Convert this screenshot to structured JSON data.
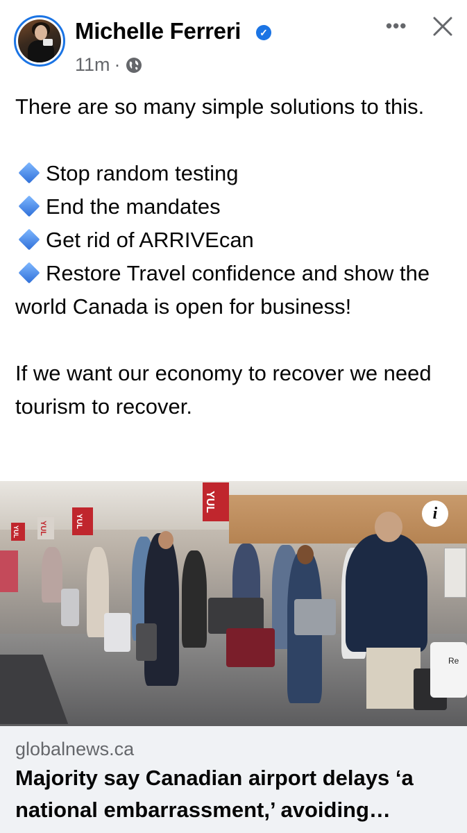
{
  "post": {
    "author": "Michelle Ferreri",
    "time": "11m",
    "separator": "·",
    "more_label": "•••",
    "text": {
      "intro": "There are so many simple solutions to this.",
      "bullets": [
        "Stop random testing",
        "End the mandates",
        "Get rid of ARRIVEcan",
        "Restore Travel confidence and show the world Canada is open for business!"
      ],
      "outro": "If we want our economy to recover we need tourism to recover."
    }
  },
  "photo": {
    "banner_text": "YUL",
    "info_label": "i",
    "bag_text": "Re"
  },
  "link": {
    "domain": "globalnews.ca",
    "headline": "Majority say Canadian airport delays ‘a national embarrassment,’ avoiding…"
  },
  "icons": {
    "verified": "verified-badge-icon",
    "audience": "globe-icon",
    "more": "more-icon",
    "close": "close-icon",
    "bullet": "blue-diamond-icon",
    "info": "info-icon"
  },
  "colors": {
    "accent": "#1b74e4",
    "secondary_text": "#65676b",
    "link_card_bg": "#f0f2f5",
    "bullet": "#3d7ee0"
  }
}
